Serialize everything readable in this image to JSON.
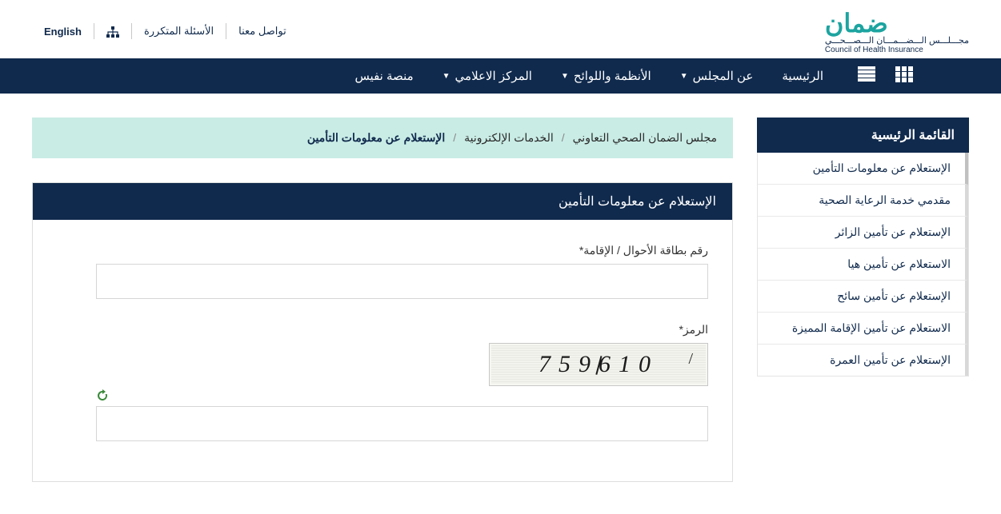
{
  "top": {
    "english": "English",
    "faq": "الأسئلة المتكررة",
    "contact": "تواصل معنا"
  },
  "logo": {
    "main": "ضمان",
    "sub1": "مجـــلـــس الـــضـــمـــان الـــصـــحـــي",
    "sub2": "Council of Health Insurance"
  },
  "nav": {
    "items": [
      {
        "label": "الرئيسية",
        "dropdown": false
      },
      {
        "label": "عن المجلس",
        "dropdown": true
      },
      {
        "label": "الأنظمة واللوائح",
        "dropdown": true
      },
      {
        "label": "المركز الاعلامي",
        "dropdown": true
      },
      {
        "label": "منصة نفيس",
        "dropdown": false
      }
    ]
  },
  "sidebar": {
    "title": "القائمة الرئيسية",
    "items": [
      {
        "label": "الإستعلام عن معلومات التأمين",
        "active": true
      },
      {
        "label": "مقدمي خدمة الرعاية الصحية",
        "active": false
      },
      {
        "label": "الإستعلام عن تأمين الزائر",
        "active": false
      },
      {
        "label": "الاستعلام عن تأمين هيا",
        "active": false
      },
      {
        "label": "الإستعلام عن تأمين سائح",
        "active": false
      },
      {
        "label": "الاستعلام عن تأمين الإقامة المميزة",
        "active": false
      },
      {
        "label": "الإستعلام عن تأمين العمرة",
        "active": false
      }
    ]
  },
  "breadcrumb": {
    "a": "مجلس الضمان الصحي التعاوني",
    "b": "الخدمات الإلكترونية",
    "current": "الإستعلام عن معلومات التأمين"
  },
  "panel": {
    "title": "الإستعلام عن معلومات التأمين"
  },
  "form": {
    "id_label": "رقم بطاقة الأحوال / الإقامة*",
    "id_value": "",
    "captcha_label": "الرمز*",
    "captcha_text": "759610",
    "captcha_value": ""
  }
}
